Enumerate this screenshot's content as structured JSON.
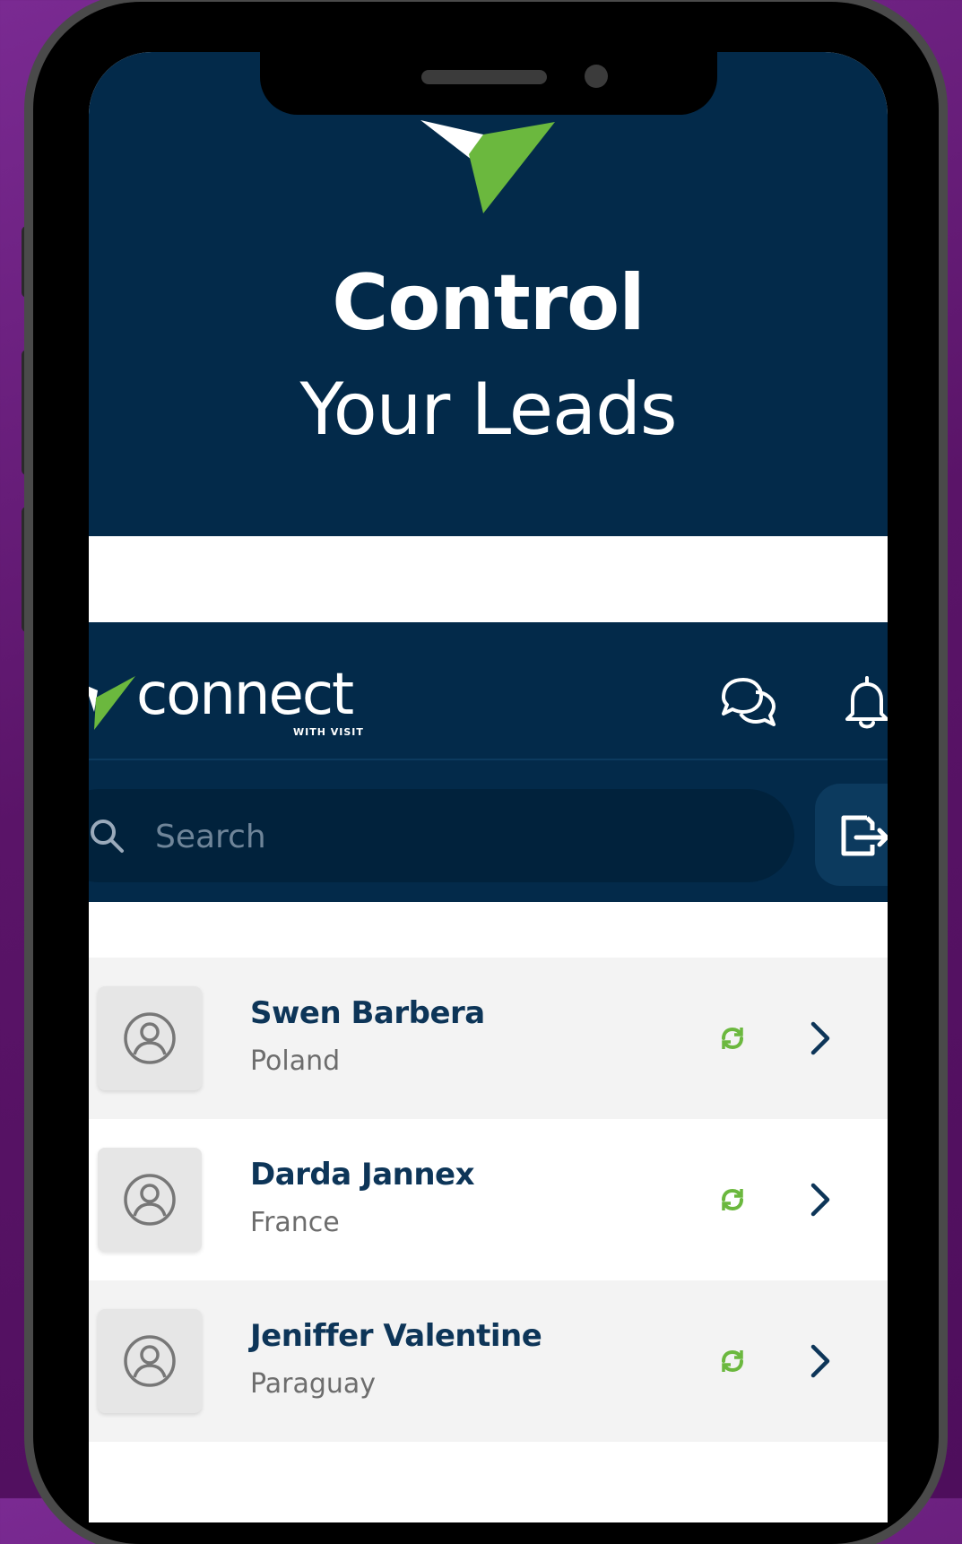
{
  "hero": {
    "title": "Control",
    "subtitle": "Your Leads",
    "logo_icon": "checkmark-logo-icon"
  },
  "app": {
    "brand": "connect",
    "brand_tag": "WITH VISIT",
    "icons": {
      "chat": "chat-bubbles-icon",
      "bell": "bell-icon",
      "search": "search-icon",
      "export": "export-file-icon",
      "sync": "sync-icon",
      "chevron": "chevron-right-icon",
      "avatar": "user-avatar-icon"
    },
    "colors": {
      "navy": "#032a4a",
      "green": "#6bb83e",
      "name_text": "#0d3558"
    }
  },
  "search": {
    "placeholder": "Search",
    "value": ""
  },
  "leads": [
    {
      "name": "Swen Barbera",
      "country": "Poland"
    },
    {
      "name": "Darda Jannex",
      "country": "France"
    },
    {
      "name": "Jeniffer Valentine",
      "country": "Paraguay"
    }
  ]
}
